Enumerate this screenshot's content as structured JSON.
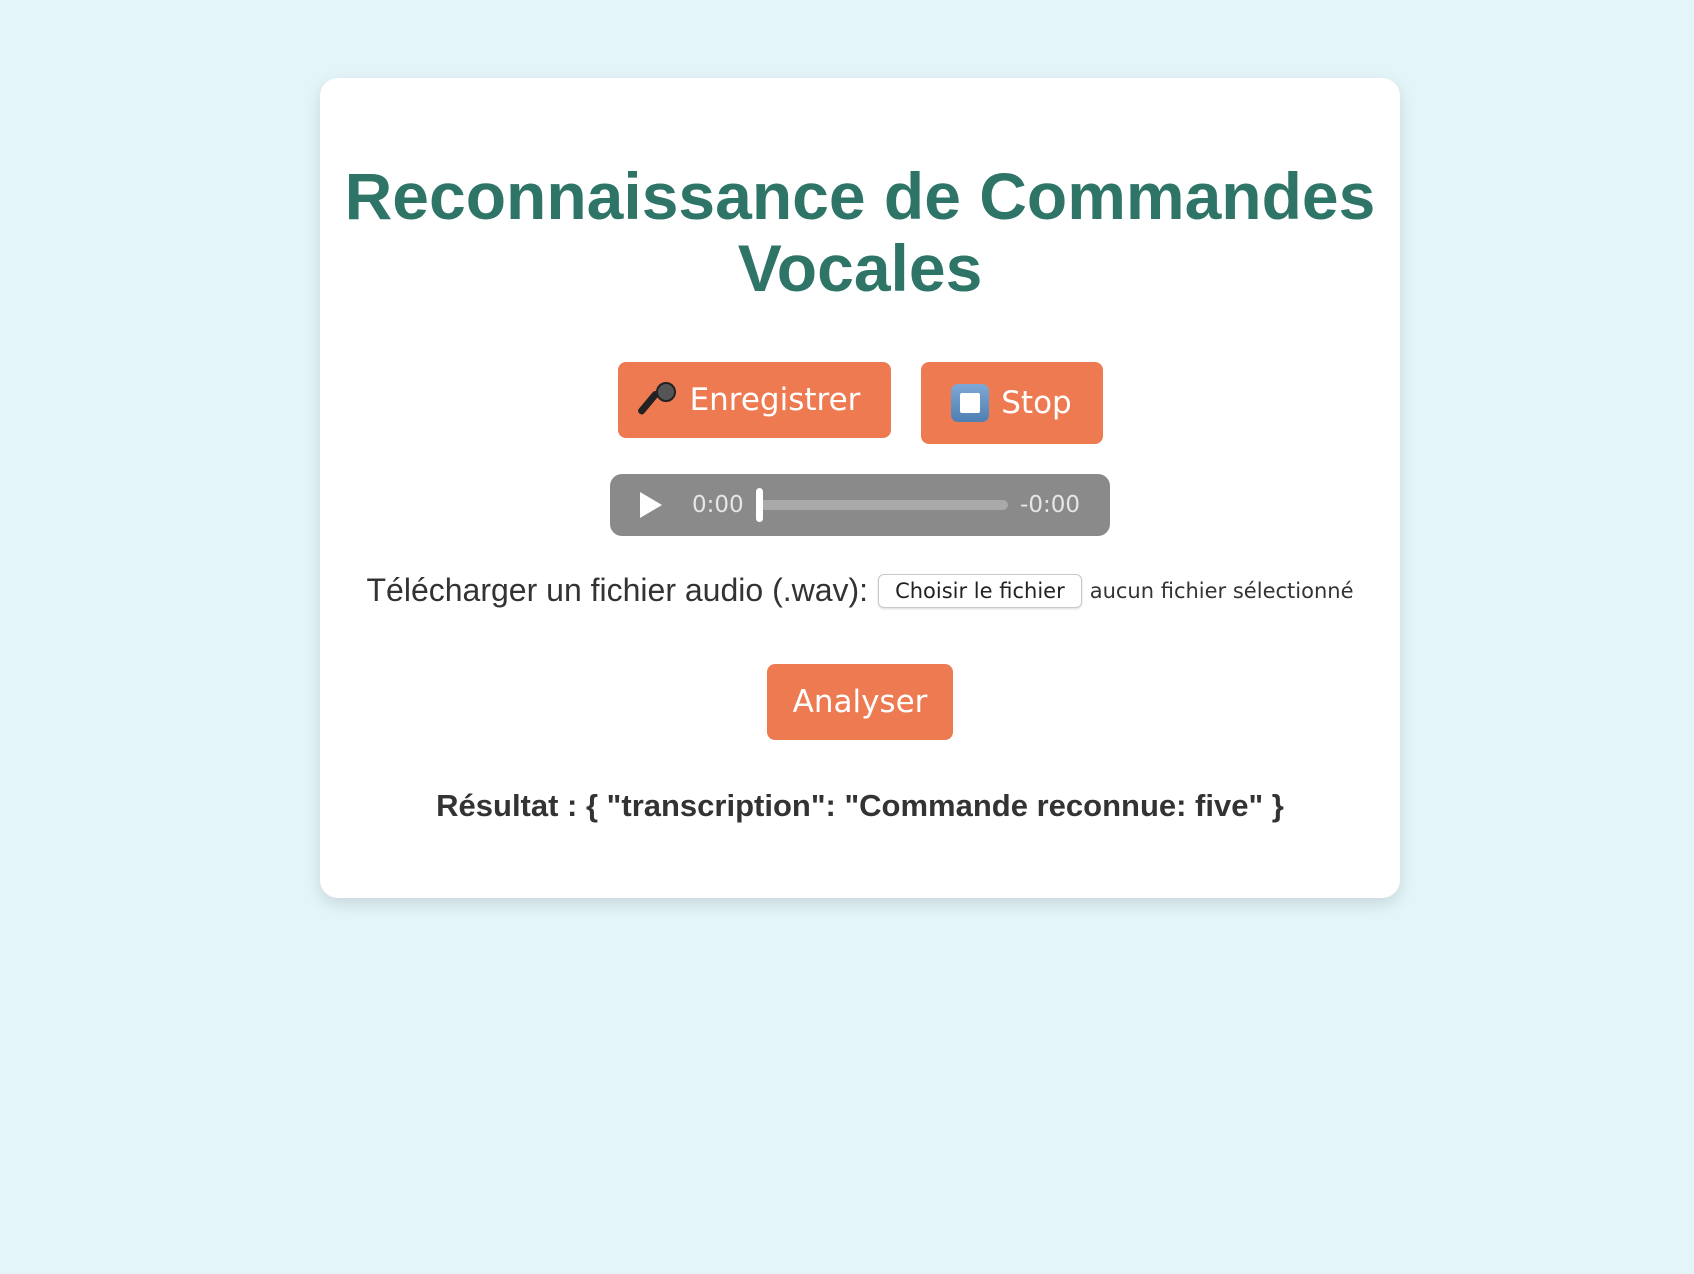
{
  "page": {
    "title": "Reconnaissance de Commandes Vocales"
  },
  "controls": {
    "record_label": "Enregistrer",
    "record_icon": "microphone-icon",
    "stop_label": "Stop",
    "stop_icon": "stop-button-icon"
  },
  "audio": {
    "current_time": "0:00",
    "remaining_time": "-0:00",
    "progress": 0
  },
  "upload": {
    "label": "Télécharger un fichier audio (.wav):",
    "button_label": "Choisir le fichier",
    "status": "aucun fichier sélectionné"
  },
  "analyze": {
    "label": "Analyser"
  },
  "result": {
    "text": "Résultat : { \"transcription\": \"Commande reconnue: five\" }"
  },
  "colors": {
    "background": "#e3f5f9",
    "title": "#2e7568",
    "button": "#ee7a52"
  }
}
